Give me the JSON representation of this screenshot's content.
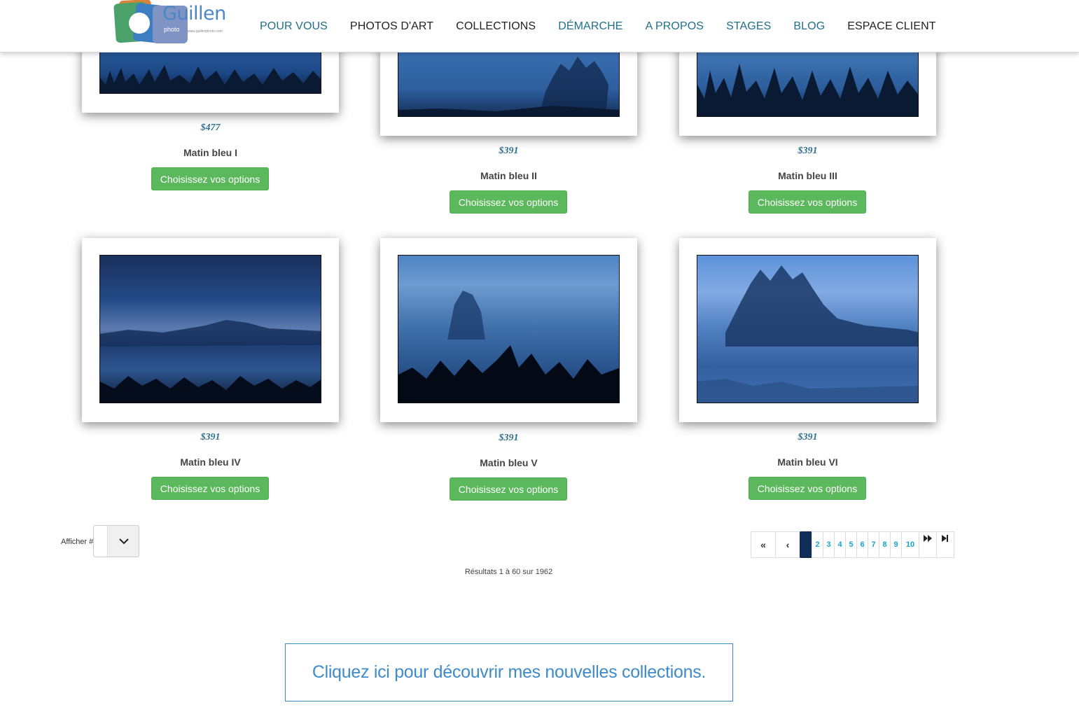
{
  "header": {
    "logo": {
      "brand": "Guillen",
      "sub": "photo",
      "url": "www.guillenphoto.com"
    },
    "nav": [
      {
        "label": "POUR VOUS",
        "color": "#1f6f88"
      },
      {
        "label": "PHOTOS D'ART",
        "color": "#222222"
      },
      {
        "label": "COLLECTIONS",
        "color": "#222222"
      },
      {
        "label": "DÉMARCHE",
        "color": "#1f6f88"
      },
      {
        "label": "A PROPOS",
        "color": "#1f6f88"
      },
      {
        "label": "STAGES",
        "color": "#1f6f88"
      },
      {
        "label": "BLOG",
        "color": "#1f6f88"
      },
      {
        "label": "ESPACE CLIENT",
        "color": "#222222"
      }
    ]
  },
  "products": [
    {
      "price": "$477",
      "title": "Matin bleu I",
      "button": "Choisissez vos options"
    },
    {
      "price": "$391",
      "title": "Matin bleu II",
      "button": "Choisissez vos options"
    },
    {
      "price": "$391",
      "title": "Matin bleu III",
      "button": "Choisissez vos options"
    },
    {
      "price": "$391",
      "title": "Matin bleu IV",
      "button": "Choisissez vos options"
    },
    {
      "price": "$391",
      "title": "Matin bleu V",
      "button": "Choisissez vos options"
    },
    {
      "price": "$391",
      "title": "Matin bleu VI",
      "button": "Choisissez vos options"
    }
  ],
  "controls": {
    "afficher_label": "Afficher #",
    "pagination": {
      "first": "«",
      "prev": "‹",
      "current": "1",
      "pages": [
        "2",
        "3",
        "4",
        "5",
        "6",
        "7",
        "8",
        "9",
        "10"
      ],
      "next": "⏩",
      "last": "⏭"
    },
    "results": "Résultats 1 à 60 sur 1962"
  },
  "promo": {
    "text": "Cliquez ici pour découvrir mes nouvelles collections."
  },
  "colors": {
    "button_green": "#5cb85c",
    "nav_blue": "#1f6f88",
    "price_blue": "#2f6f8f",
    "active_page": "#0f2d57"
  }
}
